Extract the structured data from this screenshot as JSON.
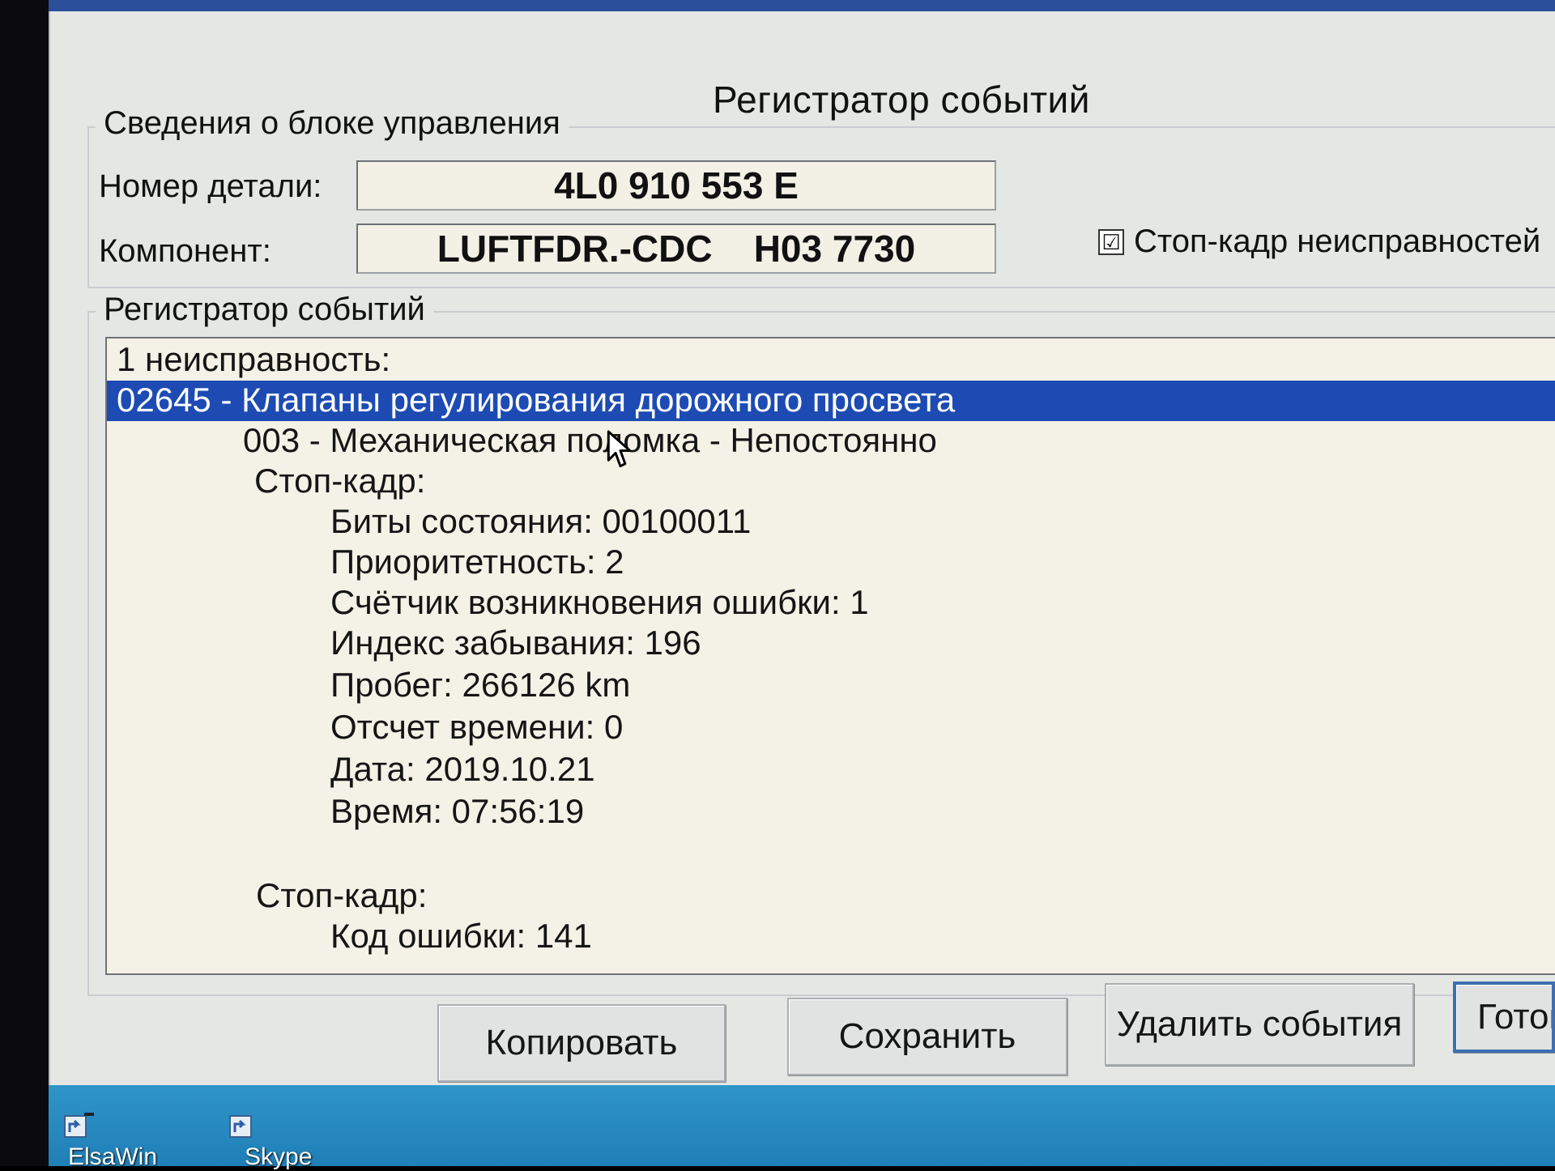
{
  "dialog": {
    "title": "Регистратор событий"
  },
  "control_unit": {
    "legend": "Сведения о блоке управления",
    "part_number_label": "Номер детали:",
    "part_number_value": "4L0 910 553 E",
    "component_label": "Компонент:",
    "component_value": "LUFTFDR.-CDC    H03 7730",
    "freeze_frame_checkbox_label": "Стоп-кадр неисправностей",
    "freeze_frame_checked": true,
    "checkbox_mark": "☑"
  },
  "event_log": {
    "legend": "Регистратор событий",
    "lines": [
      "1 неисправность:",
      "02645 - Клапаны регулирования дорожного просвета",
      "003 - Механическая поломка - Непостоянно",
      "Стоп-кадр:",
      "Биты состояния: 00100011",
      "Приоритетность: 2",
      "Счётчик возникновения ошибки: 1",
      "Индекс забывания: 196",
      "Пробег: 266126 km",
      "Отсчет времени: 0",
      "Дата: 2019.10.21",
      "Время: 07:56:19",
      "Стоп-кадр:",
      "Код ошибки: 141"
    ]
  },
  "buttons": {
    "copy": "Копировать",
    "save": "Сохранить",
    "delete_events": "Удалить события",
    "done": "Готов"
  },
  "desktop": {
    "icons": [
      {
        "label": "ElsaWin",
        "icon": "shortcut-icon"
      },
      {
        "label": "Skype",
        "icon": "shortcut-icon"
      }
    ]
  },
  "colors": {
    "window_bg": "#e4e7e4",
    "selection": "#1d4bb3",
    "log_bg": "#f4f2e6",
    "desktop": "#2f95c9"
  }
}
